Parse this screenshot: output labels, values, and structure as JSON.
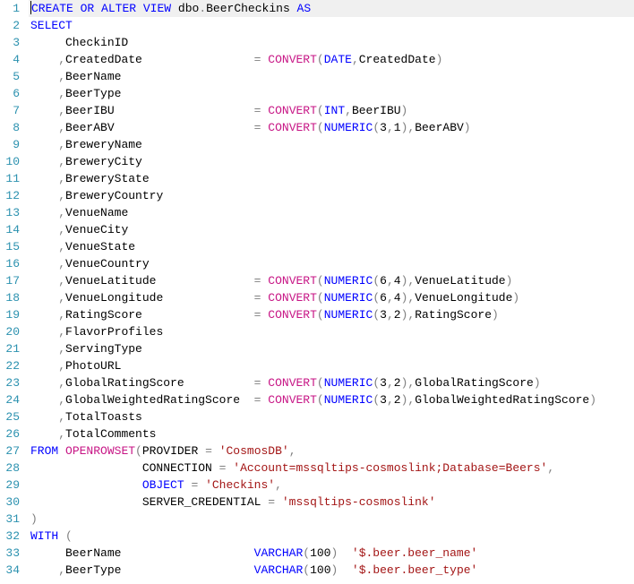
{
  "code": {
    "lines": [
      {
        "n": 1,
        "segments": [
          {
            "cursor": true
          },
          {
            "t": "CREATE",
            "c": "kw"
          },
          {
            "t": " "
          },
          {
            "t": "OR",
            "c": "kw"
          },
          {
            "t": " "
          },
          {
            "t": "ALTER",
            "c": "kw"
          },
          {
            "t": " "
          },
          {
            "t": "VIEW",
            "c": "kw"
          },
          {
            "t": " dbo"
          },
          {
            "t": ".",
            "c": "gray"
          },
          {
            "t": "BeerCheckins "
          },
          {
            "t": "AS",
            "c": "kw"
          }
        ]
      },
      {
        "n": 2,
        "segments": [
          {
            "t": "SELECT",
            "c": "kw"
          }
        ]
      },
      {
        "n": 3,
        "segments": [
          {
            "t": "     CheckinID"
          }
        ]
      },
      {
        "n": 4,
        "segments": [
          {
            "t": "    "
          },
          {
            "t": ",",
            "c": "gray"
          },
          {
            "t": "CreatedDate                "
          },
          {
            "t": "=",
            "c": "gray"
          },
          {
            "t": " "
          },
          {
            "t": "CONVERT",
            "c": "func"
          },
          {
            "t": "(",
            "c": "gray"
          },
          {
            "t": "DATE",
            "c": "kw"
          },
          {
            "t": ",",
            "c": "gray"
          },
          {
            "t": "CreatedDate"
          },
          {
            "t": ")",
            "c": "gray"
          }
        ]
      },
      {
        "n": 5,
        "segments": [
          {
            "t": "    "
          },
          {
            "t": ",",
            "c": "gray"
          },
          {
            "t": "BeerName"
          }
        ]
      },
      {
        "n": 6,
        "segments": [
          {
            "t": "    "
          },
          {
            "t": ",",
            "c": "gray"
          },
          {
            "t": "BeerType"
          }
        ]
      },
      {
        "n": 7,
        "segments": [
          {
            "t": "    "
          },
          {
            "t": ",",
            "c": "gray"
          },
          {
            "t": "BeerIBU                    "
          },
          {
            "t": "=",
            "c": "gray"
          },
          {
            "t": " "
          },
          {
            "t": "CONVERT",
            "c": "func"
          },
          {
            "t": "(",
            "c": "gray"
          },
          {
            "t": "INT",
            "c": "kw"
          },
          {
            "t": ",",
            "c": "gray"
          },
          {
            "t": "BeerIBU"
          },
          {
            "t": ")",
            "c": "gray"
          }
        ]
      },
      {
        "n": 8,
        "segments": [
          {
            "t": "    "
          },
          {
            "t": ",",
            "c": "gray"
          },
          {
            "t": "BeerABV                    "
          },
          {
            "t": "=",
            "c": "gray"
          },
          {
            "t": " "
          },
          {
            "t": "CONVERT",
            "c": "func"
          },
          {
            "t": "(",
            "c": "gray"
          },
          {
            "t": "NUMERIC",
            "c": "kw"
          },
          {
            "t": "(",
            "c": "gray"
          },
          {
            "t": "3"
          },
          {
            "t": ",",
            "c": "gray"
          },
          {
            "t": "1"
          },
          {
            "t": "),",
            "c": "gray"
          },
          {
            "t": "BeerABV"
          },
          {
            "t": ")",
            "c": "gray"
          }
        ]
      },
      {
        "n": 9,
        "segments": [
          {
            "t": "    "
          },
          {
            "t": ",",
            "c": "gray"
          },
          {
            "t": "BreweryName"
          }
        ]
      },
      {
        "n": 10,
        "segments": [
          {
            "t": "    "
          },
          {
            "t": ",",
            "c": "gray"
          },
          {
            "t": "BreweryCity"
          }
        ]
      },
      {
        "n": 11,
        "segments": [
          {
            "t": "    "
          },
          {
            "t": ",",
            "c": "gray"
          },
          {
            "t": "BreweryState"
          }
        ]
      },
      {
        "n": 12,
        "segments": [
          {
            "t": "    "
          },
          {
            "t": ",",
            "c": "gray"
          },
          {
            "t": "BreweryCountry"
          }
        ]
      },
      {
        "n": 13,
        "segments": [
          {
            "t": "    "
          },
          {
            "t": ",",
            "c": "gray"
          },
          {
            "t": "VenueName"
          }
        ]
      },
      {
        "n": 14,
        "segments": [
          {
            "t": "    "
          },
          {
            "t": ",",
            "c": "gray"
          },
          {
            "t": "VenueCity"
          }
        ]
      },
      {
        "n": 15,
        "segments": [
          {
            "t": "    "
          },
          {
            "t": ",",
            "c": "gray"
          },
          {
            "t": "VenueState"
          }
        ]
      },
      {
        "n": 16,
        "segments": [
          {
            "t": "    "
          },
          {
            "t": ",",
            "c": "gray"
          },
          {
            "t": "VenueCountry"
          }
        ]
      },
      {
        "n": 17,
        "segments": [
          {
            "t": "    "
          },
          {
            "t": ",",
            "c": "gray"
          },
          {
            "t": "VenueLatitude              "
          },
          {
            "t": "=",
            "c": "gray"
          },
          {
            "t": " "
          },
          {
            "t": "CONVERT",
            "c": "func"
          },
          {
            "t": "(",
            "c": "gray"
          },
          {
            "t": "NUMERIC",
            "c": "kw"
          },
          {
            "t": "(",
            "c": "gray"
          },
          {
            "t": "6"
          },
          {
            "t": ",",
            "c": "gray"
          },
          {
            "t": "4"
          },
          {
            "t": "),",
            "c": "gray"
          },
          {
            "t": "VenueLatitude"
          },
          {
            "t": ")",
            "c": "gray"
          }
        ]
      },
      {
        "n": 18,
        "segments": [
          {
            "t": "    "
          },
          {
            "t": ",",
            "c": "gray"
          },
          {
            "t": "VenueLongitude             "
          },
          {
            "t": "=",
            "c": "gray"
          },
          {
            "t": " "
          },
          {
            "t": "CONVERT",
            "c": "func"
          },
          {
            "t": "(",
            "c": "gray"
          },
          {
            "t": "NUMERIC",
            "c": "kw"
          },
          {
            "t": "(",
            "c": "gray"
          },
          {
            "t": "6"
          },
          {
            "t": ",",
            "c": "gray"
          },
          {
            "t": "4"
          },
          {
            "t": "),",
            "c": "gray"
          },
          {
            "t": "VenueLongitude"
          },
          {
            "t": ")",
            "c": "gray"
          }
        ]
      },
      {
        "n": 19,
        "segments": [
          {
            "t": "    "
          },
          {
            "t": ",",
            "c": "gray"
          },
          {
            "t": "RatingScore                "
          },
          {
            "t": "=",
            "c": "gray"
          },
          {
            "t": " "
          },
          {
            "t": "CONVERT",
            "c": "func"
          },
          {
            "t": "(",
            "c": "gray"
          },
          {
            "t": "NUMERIC",
            "c": "kw"
          },
          {
            "t": "(",
            "c": "gray"
          },
          {
            "t": "3"
          },
          {
            "t": ",",
            "c": "gray"
          },
          {
            "t": "2"
          },
          {
            "t": "),",
            "c": "gray"
          },
          {
            "t": "RatingScore"
          },
          {
            "t": ")",
            "c": "gray"
          }
        ]
      },
      {
        "n": 20,
        "segments": [
          {
            "t": "    "
          },
          {
            "t": ",",
            "c": "gray"
          },
          {
            "t": "FlavorProfiles"
          }
        ]
      },
      {
        "n": 21,
        "segments": [
          {
            "t": "    "
          },
          {
            "t": ",",
            "c": "gray"
          },
          {
            "t": "ServingType"
          }
        ]
      },
      {
        "n": 22,
        "segments": [
          {
            "t": "    "
          },
          {
            "t": ",",
            "c": "gray"
          },
          {
            "t": "PhotoURL"
          }
        ]
      },
      {
        "n": 23,
        "segments": [
          {
            "t": "    "
          },
          {
            "t": ",",
            "c": "gray"
          },
          {
            "t": "GlobalRatingScore          "
          },
          {
            "t": "=",
            "c": "gray"
          },
          {
            "t": " "
          },
          {
            "t": "CONVERT",
            "c": "func"
          },
          {
            "t": "(",
            "c": "gray"
          },
          {
            "t": "NUMERIC",
            "c": "kw"
          },
          {
            "t": "(",
            "c": "gray"
          },
          {
            "t": "3"
          },
          {
            "t": ",",
            "c": "gray"
          },
          {
            "t": "2"
          },
          {
            "t": "),",
            "c": "gray"
          },
          {
            "t": "GlobalRatingScore"
          },
          {
            "t": ")",
            "c": "gray"
          }
        ]
      },
      {
        "n": 24,
        "segments": [
          {
            "t": "    "
          },
          {
            "t": ",",
            "c": "gray"
          },
          {
            "t": "GlobalWeightedRatingScore  "
          },
          {
            "t": "=",
            "c": "gray"
          },
          {
            "t": " "
          },
          {
            "t": "CONVERT",
            "c": "func"
          },
          {
            "t": "(",
            "c": "gray"
          },
          {
            "t": "NUMERIC",
            "c": "kw"
          },
          {
            "t": "(",
            "c": "gray"
          },
          {
            "t": "3"
          },
          {
            "t": ",",
            "c": "gray"
          },
          {
            "t": "2"
          },
          {
            "t": "),",
            "c": "gray"
          },
          {
            "t": "GlobalWeightedRatingScore"
          },
          {
            "t": ")",
            "c": "gray"
          }
        ]
      },
      {
        "n": 25,
        "segments": [
          {
            "t": "    "
          },
          {
            "t": ",",
            "c": "gray"
          },
          {
            "t": "TotalToasts"
          }
        ]
      },
      {
        "n": 26,
        "segments": [
          {
            "t": "    "
          },
          {
            "t": ",",
            "c": "gray"
          },
          {
            "t": "TotalComments"
          }
        ]
      },
      {
        "n": 27,
        "segments": [
          {
            "t": "FROM",
            "c": "kw"
          },
          {
            "t": " "
          },
          {
            "t": "OPENROWSET",
            "c": "func"
          },
          {
            "t": "(",
            "c": "gray"
          },
          {
            "t": "PROVIDER "
          },
          {
            "t": "=",
            "c": "gray"
          },
          {
            "t": " "
          },
          {
            "t": "'CosmosDB'",
            "c": "str"
          },
          {
            "t": ",",
            "c": "gray"
          }
        ]
      },
      {
        "n": 28,
        "segments": [
          {
            "t": "                CONNECTION "
          },
          {
            "t": "=",
            "c": "gray"
          },
          {
            "t": " "
          },
          {
            "t": "'Account=mssqltips-cosmoslink;Database=Beers'",
            "c": "str"
          },
          {
            "t": ",",
            "c": "gray"
          }
        ]
      },
      {
        "n": 29,
        "segments": [
          {
            "t": "                "
          },
          {
            "t": "OBJECT",
            "c": "kw"
          },
          {
            "t": " "
          },
          {
            "t": "=",
            "c": "gray"
          },
          {
            "t": " "
          },
          {
            "t": "'Checkins'",
            "c": "str"
          },
          {
            "t": ",",
            "c": "gray"
          }
        ]
      },
      {
        "n": 30,
        "segments": [
          {
            "t": "                SERVER_CREDENTIAL "
          },
          {
            "t": "=",
            "c": "gray"
          },
          {
            "t": " "
          },
          {
            "t": "'mssqltips-cosmoslink'",
            "c": "str"
          }
        ]
      },
      {
        "n": 31,
        "segments": [
          {
            "t": ")",
            "c": "gray"
          }
        ]
      },
      {
        "n": 32,
        "segments": [
          {
            "t": "WITH",
            "c": "kw"
          },
          {
            "t": " "
          },
          {
            "t": "(",
            "c": "gray"
          }
        ]
      },
      {
        "n": 33,
        "segments": [
          {
            "t": "     BeerName                   "
          },
          {
            "t": "VARCHAR",
            "c": "kw"
          },
          {
            "t": "(",
            "c": "gray"
          },
          {
            "t": "100"
          },
          {
            "t": ")",
            "c": "gray"
          },
          {
            "t": "  "
          },
          {
            "t": "'$.beer.beer_name'",
            "c": "str"
          }
        ]
      },
      {
        "n": 34,
        "segments": [
          {
            "t": "    "
          },
          {
            "t": ",",
            "c": "gray"
          },
          {
            "t": "BeerType                   "
          },
          {
            "t": "VARCHAR",
            "c": "kw"
          },
          {
            "t": "(",
            "c": "gray"
          },
          {
            "t": "100"
          },
          {
            "t": ")",
            "c": "gray"
          },
          {
            "t": "  "
          },
          {
            "t": "'$.beer.beer_type'",
            "c": "str"
          }
        ]
      }
    ]
  }
}
